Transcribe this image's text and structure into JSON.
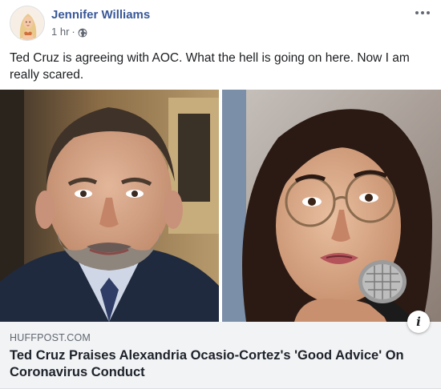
{
  "post": {
    "author_name": "Jennifer Williams",
    "timestamp": "1 hr",
    "separator": "·",
    "privacy_icon": "globe-icon",
    "options_icon": "more-options-icon",
    "text": "Ted Cruz is agreeing with AOC. What the hell is going on here. Now I am really scared."
  },
  "link_preview": {
    "domain": "HUFFPOST.COM",
    "headline": "Ted Cruz Praises Alexandria Ocasio-Cortez's 'Good Advice' On Coronavirus Conduct",
    "info_label": "i",
    "info_icon": "info-icon",
    "left_image": "photo-man-suit",
    "right_image": "photo-woman-glasses-microphone"
  },
  "colors": {
    "author_link": "#385898",
    "secondary_text": "#606770",
    "caption_background": "#f2f3f5"
  }
}
